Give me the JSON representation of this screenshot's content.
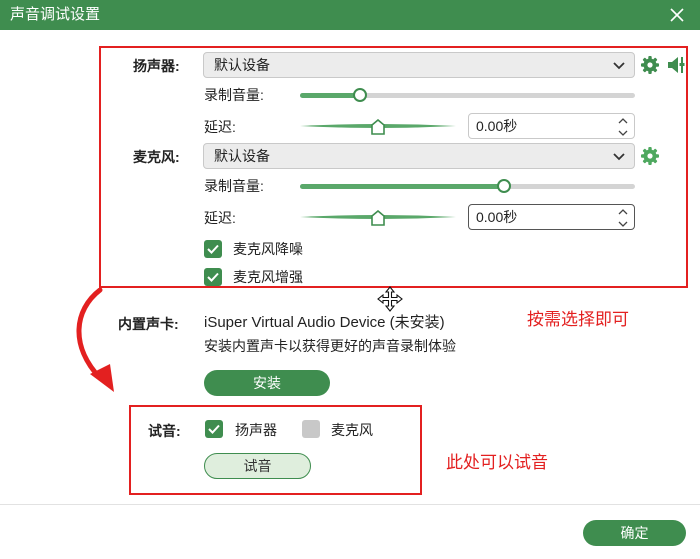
{
  "window": {
    "title": "声音调试设置"
  },
  "speaker": {
    "label": "扬声器:",
    "device": "默认设备",
    "volume_label": "录制音量:",
    "volume_level": 0.18,
    "delay_label": "延迟:",
    "delay_level": 0.5,
    "delay_value": "0.00秒"
  },
  "microphone": {
    "label": "麦克风:",
    "device": "默认设备",
    "volume_label": "录制音量:",
    "volume_level": 0.61,
    "delay_label": "延迟:",
    "delay_level": 0.5,
    "delay_value": "0.00秒",
    "noise_reduction_label": "麦克风降噪",
    "noise_reduction_checked": true,
    "enhance_label": "麦克风增强",
    "enhance_checked": true
  },
  "soundcard": {
    "label": "内置声卡:",
    "device_name": "iSuper Virtual Audio Device (未安装)",
    "hint": "安装内置声卡以获得更好的声音录制体验",
    "install_label": "安装"
  },
  "test": {
    "label": "试音:",
    "speaker_label": "扬声器",
    "speaker_checked": true,
    "mic_label": "麦克风",
    "mic_checked": false,
    "button_label": "试音"
  },
  "footer": {
    "ok_label": "确定"
  },
  "annotations": {
    "choose_note": "按需选择即可",
    "test_note": "此处可以试音"
  },
  "colors": {
    "accent": "#3f8d4f",
    "annotation": "#e32020"
  },
  "icons": [
    "close-icon",
    "chevron-down-icon",
    "gear-icon",
    "speaker-icon",
    "check-icon",
    "move-cursor-icon",
    "red-arrow-icon"
  ]
}
